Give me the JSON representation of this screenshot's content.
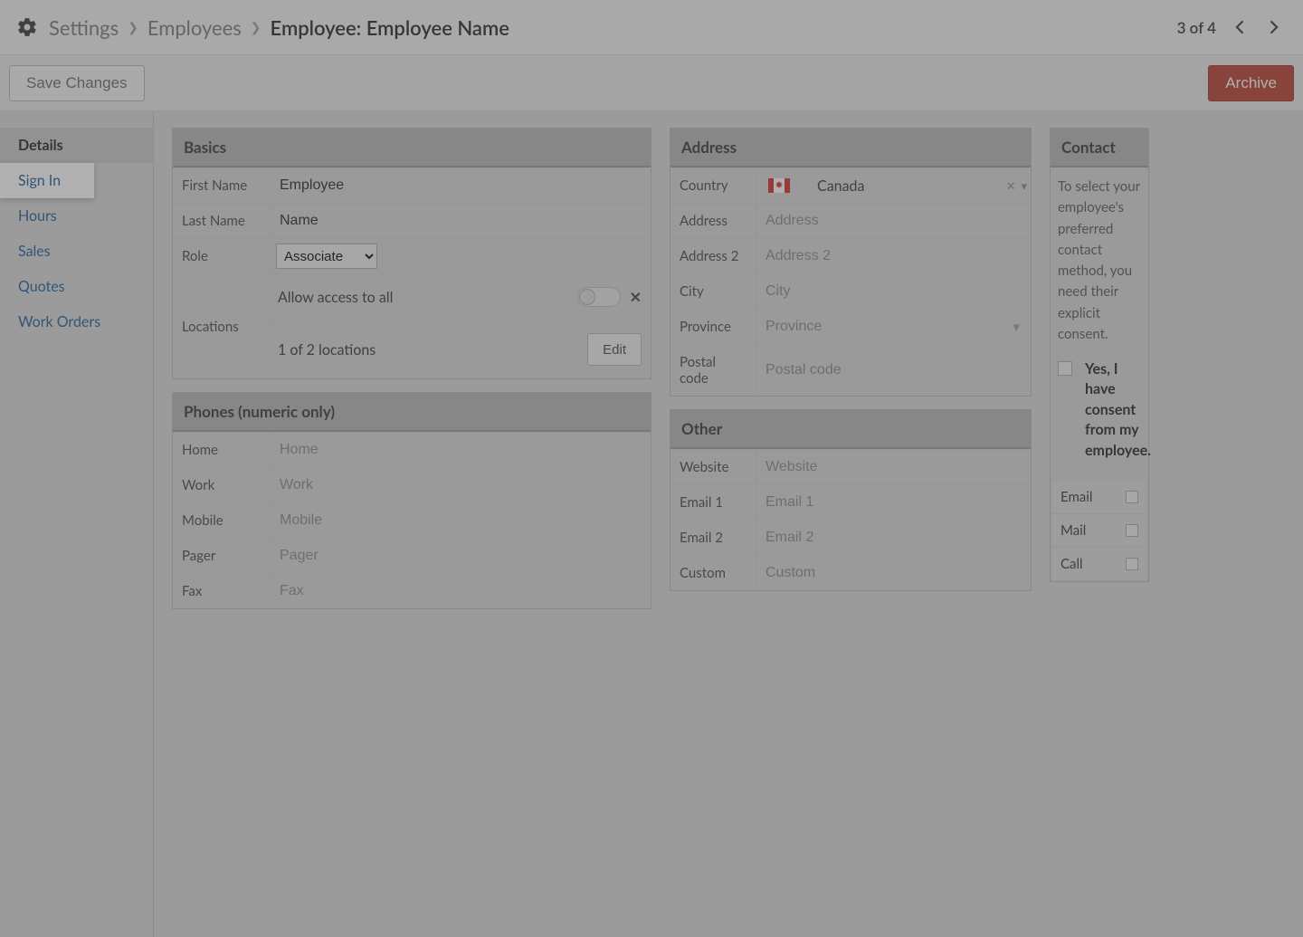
{
  "breadcrumb": {
    "root": "Settings",
    "mid": "Employees",
    "current": "Employee: Employee Name"
  },
  "pager": {
    "text": "3 of 4"
  },
  "buttons": {
    "save": "Save Changes",
    "archive": "Archive",
    "edit": "Edit"
  },
  "sidebar": {
    "items": [
      {
        "label": "Details"
      },
      {
        "label": "Sign In"
      },
      {
        "label": "Hours"
      },
      {
        "label": "Sales"
      },
      {
        "label": "Quotes"
      },
      {
        "label": "Work Orders"
      }
    ]
  },
  "basics": {
    "title": "Basics",
    "first_name_label": "First Name",
    "first_name_value": "Employee",
    "last_name_label": "Last Name",
    "last_name_value": "Name",
    "role_label": "Role",
    "role_value": "Associate",
    "locations_label": "Locations",
    "allow_label": "Allow access to all",
    "loc_summary": "1 of 2 locations"
  },
  "phones": {
    "title": "Phones (numeric only)",
    "rows": [
      {
        "label": "Home",
        "ph": "Home"
      },
      {
        "label": "Work",
        "ph": "Work"
      },
      {
        "label": "Mobile",
        "ph": "Mobile"
      },
      {
        "label": "Pager",
        "ph": "Pager"
      },
      {
        "label": "Fax",
        "ph": "Fax"
      }
    ]
  },
  "address": {
    "title": "Address",
    "country_label": "Country",
    "country_value": "Canada",
    "rows": [
      {
        "label": "Address",
        "ph": "Address"
      },
      {
        "label": "Address 2",
        "ph": "Address 2"
      },
      {
        "label": "City",
        "ph": "City"
      },
      {
        "label": "Province",
        "ph": "Province"
      },
      {
        "label": "Postal code",
        "ph": "Postal code"
      }
    ]
  },
  "other": {
    "title": "Other",
    "rows": [
      {
        "label": "Website",
        "ph": "Website"
      },
      {
        "label": "Email 1",
        "ph": "Email 1"
      },
      {
        "label": "Email 2",
        "ph": "Email 2"
      },
      {
        "label": "Custom",
        "ph": "Custom"
      }
    ]
  },
  "contact": {
    "title": "Contact",
    "text": "To select your employee's preferred contact method, you need their explicit consent.",
    "consent": "Yes, I have consent from my employee.",
    "methods": [
      {
        "label": "Email"
      },
      {
        "label": "Mail"
      },
      {
        "label": "Call"
      }
    ]
  }
}
